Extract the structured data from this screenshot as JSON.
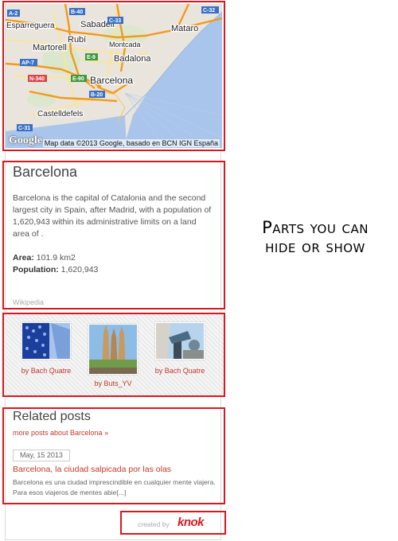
{
  "map": {
    "credit": "Map data ©2013 Google, basado en BCN IGN España",
    "logo": "Google",
    "places": [
      "Sabadell",
      "Esparreguera",
      "Rubí",
      "Montcada",
      "Mataro",
      "Martorell",
      "Badalona",
      "Barcelona",
      "Castelldefels"
    ],
    "road_badges": [
      "A-2",
      "B-40",
      "C-33",
      "C-32",
      "AP-7",
      "E-9",
      "N-340",
      "E-90",
      "B-20",
      "C-31"
    ],
    "colors": {
      "land": "#e9e5dc",
      "sea": "#a9c5eb",
      "highway": "#f39a1c",
      "road": "#ffe58a"
    }
  },
  "info": {
    "title": "Barcelona",
    "description": "Barcelona is the capital of Catalonia and the second largest city in Spain, after Madrid, with a population of 1,620,943 within its administrative limits on a land area of .",
    "area_label": "Area:",
    "area_value": "101.9 km2",
    "population_label": "Population:",
    "population_value": "1,620,943",
    "source": "Wikipedia"
  },
  "gallery": {
    "items": [
      {
        "caption": "by Bach Quatre"
      },
      {
        "caption": "by Buts_YV"
      },
      {
        "caption": "by Bach Quatre"
      }
    ]
  },
  "related": {
    "title": "Related posts",
    "more_link": "more posts about Barcelona »",
    "post": {
      "date": "May, 15 2013",
      "title": "Barcelona, la ciudad salpicada por las olas",
      "excerpt": "Barcelona es una ciudad imprescindible en cualquier mente viajera. Para esos viajeros de mentes abie[...]"
    }
  },
  "credits": {
    "label": "created by",
    "brand": "knok"
  },
  "annotation": {
    "line1": "Parts you can",
    "line2": "hide or show"
  },
  "accent_color": "#d8181e"
}
